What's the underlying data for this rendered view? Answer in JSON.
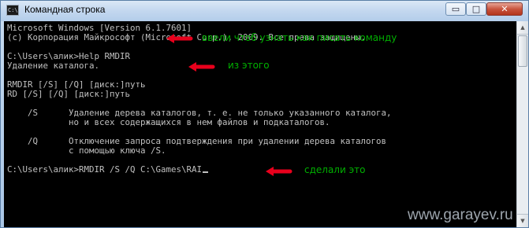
{
  "window": {
    "title": "Командная строка",
    "app_icon_text": "C:\\",
    "min_label": "▭",
    "max_label": "□",
    "close_label": "✕"
  },
  "console": {
    "lines": [
      "Microsoft Windows [Version 6.1.7601]",
      "(c) Корпорация Майкрософт (Microsoft Corp.), 2009. Все права защищены.",
      "",
      "C:\\Users\\алик>Help RMDIR",
      "Удаление каталога.",
      "",
      "RMDIR [/S] [/Q] [диск:]путь",
      "RD [/S] [/Q] [диск:]путь",
      "",
      "    /S      Удаление дерева каталогов, т. е. не только указанного каталога,",
      "            но и всех содержащихся в нем файлов и подкаталогов.",
      "",
      "    /Q      Отключение запроса подтверждения при удалении дерева каталогов",
      "            с помощью ключа /S.",
      "",
      "C:\\Users\\алик>RMDIR /S /Q C:\\Games\\RAI"
    ]
  },
  "annotations": {
    "a1": "ввели чтоб узнать как писать команду",
    "a2": "из этого",
    "a3": "сделали это",
    "color": "#00b000",
    "arrow_color": "#e8001c"
  },
  "watermark": "www.garayev.ru"
}
